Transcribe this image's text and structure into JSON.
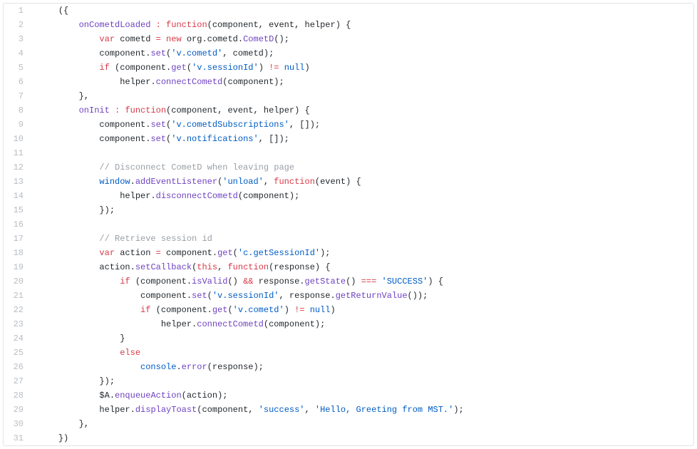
{
  "lines": [
    {
      "n": 1,
      "indent": 1,
      "tokens": [
        {
          "c": "t-punct",
          "t": "({"
        }
      ]
    },
    {
      "n": 2,
      "indent": 2,
      "tokens": [
        {
          "c": "t-func",
          "t": "onCometdLoaded"
        },
        {
          "c": "t-name",
          "t": " "
        },
        {
          "c": "t-op",
          "t": ":"
        },
        {
          "c": "t-name",
          "t": " "
        },
        {
          "c": "t-kw",
          "t": "function"
        },
        {
          "c": "t-punct",
          "t": "("
        },
        {
          "c": "t-name",
          "t": "component"
        },
        {
          "c": "t-punct",
          "t": ","
        },
        {
          "c": "t-name",
          "t": " event"
        },
        {
          "c": "t-punct",
          "t": ","
        },
        {
          "c": "t-name",
          "t": " helper"
        },
        {
          "c": "t-punct",
          "t": ")"
        },
        {
          "c": "t-name",
          "t": " "
        },
        {
          "c": "t-punct",
          "t": "{"
        }
      ]
    },
    {
      "n": 3,
      "indent": 3,
      "tokens": [
        {
          "c": "t-kw",
          "t": "var"
        },
        {
          "c": "t-name",
          "t": " cometd "
        },
        {
          "c": "t-op",
          "t": "="
        },
        {
          "c": "t-name",
          "t": " "
        },
        {
          "c": "t-new",
          "t": "new"
        },
        {
          "c": "t-name",
          "t": " org"
        },
        {
          "c": "t-punct",
          "t": "."
        },
        {
          "c": "t-name",
          "t": "cometd"
        },
        {
          "c": "t-punct",
          "t": "."
        },
        {
          "c": "t-func",
          "t": "CometD"
        },
        {
          "c": "t-punct",
          "t": "();"
        }
      ]
    },
    {
      "n": 4,
      "indent": 3,
      "tokens": [
        {
          "c": "t-name",
          "t": "component"
        },
        {
          "c": "t-punct",
          "t": "."
        },
        {
          "c": "t-func",
          "t": "set"
        },
        {
          "c": "t-punct",
          "t": "("
        },
        {
          "c": "t-str",
          "t": "'v.cometd'"
        },
        {
          "c": "t-punct",
          "t": ","
        },
        {
          "c": "t-name",
          "t": " cometd"
        },
        {
          "c": "t-punct",
          "t": ");"
        }
      ]
    },
    {
      "n": 5,
      "indent": 3,
      "tokens": [
        {
          "c": "t-kw",
          "t": "if"
        },
        {
          "c": "t-name",
          "t": " "
        },
        {
          "c": "t-punct",
          "t": "("
        },
        {
          "c": "t-name",
          "t": "component"
        },
        {
          "c": "t-punct",
          "t": "."
        },
        {
          "c": "t-func",
          "t": "get"
        },
        {
          "c": "t-punct",
          "t": "("
        },
        {
          "c": "t-str",
          "t": "'v.sessionId'"
        },
        {
          "c": "t-punct",
          "t": ")"
        },
        {
          "c": "t-name",
          "t": " "
        },
        {
          "c": "t-op",
          "t": "!="
        },
        {
          "c": "t-name",
          "t": " "
        },
        {
          "c": "t-null",
          "t": "null"
        },
        {
          "c": "t-punct",
          "t": ")"
        }
      ]
    },
    {
      "n": 6,
      "indent": 4,
      "tokens": [
        {
          "c": "t-name",
          "t": "helper"
        },
        {
          "c": "t-punct",
          "t": "."
        },
        {
          "c": "t-func",
          "t": "connectCometd"
        },
        {
          "c": "t-punct",
          "t": "("
        },
        {
          "c": "t-name",
          "t": "component"
        },
        {
          "c": "t-punct",
          "t": ");"
        }
      ]
    },
    {
      "n": 7,
      "indent": 2,
      "tokens": [
        {
          "c": "t-punct",
          "t": "},"
        }
      ]
    },
    {
      "n": 8,
      "indent": 2,
      "tokens": [
        {
          "c": "t-func",
          "t": "onInit"
        },
        {
          "c": "t-name",
          "t": " "
        },
        {
          "c": "t-op",
          "t": ":"
        },
        {
          "c": "t-name",
          "t": " "
        },
        {
          "c": "t-kw",
          "t": "function"
        },
        {
          "c": "t-punct",
          "t": "("
        },
        {
          "c": "t-name",
          "t": "component"
        },
        {
          "c": "t-punct",
          "t": ","
        },
        {
          "c": "t-name",
          "t": " event"
        },
        {
          "c": "t-punct",
          "t": ","
        },
        {
          "c": "t-name",
          "t": " helper"
        },
        {
          "c": "t-punct",
          "t": ")"
        },
        {
          "c": "t-name",
          "t": " "
        },
        {
          "c": "t-punct",
          "t": "{"
        }
      ]
    },
    {
      "n": 9,
      "indent": 3,
      "tokens": [
        {
          "c": "t-name",
          "t": "component"
        },
        {
          "c": "t-punct",
          "t": "."
        },
        {
          "c": "t-func",
          "t": "set"
        },
        {
          "c": "t-punct",
          "t": "("
        },
        {
          "c": "t-str",
          "t": "'v.cometdSubscriptions'"
        },
        {
          "c": "t-punct",
          "t": ","
        },
        {
          "c": "t-name",
          "t": " "
        },
        {
          "c": "t-punct",
          "t": "[]);"
        }
      ]
    },
    {
      "n": 10,
      "indent": 3,
      "tokens": [
        {
          "c": "t-name",
          "t": "component"
        },
        {
          "c": "t-punct",
          "t": "."
        },
        {
          "c": "t-func",
          "t": "set"
        },
        {
          "c": "t-punct",
          "t": "("
        },
        {
          "c": "t-str",
          "t": "'v.notifications'"
        },
        {
          "c": "t-punct",
          "t": ","
        },
        {
          "c": "t-name",
          "t": " "
        },
        {
          "c": "t-punct",
          "t": "[]);"
        }
      ]
    },
    {
      "n": 11,
      "indent": 3,
      "tokens": []
    },
    {
      "n": 12,
      "indent": 3,
      "tokens": [
        {
          "c": "t-cmt",
          "t": "// Disconnect CometD when leaving page"
        }
      ]
    },
    {
      "n": 13,
      "indent": 3,
      "tokens": [
        {
          "c": "t-builtin",
          "t": "window"
        },
        {
          "c": "t-punct",
          "t": "."
        },
        {
          "c": "t-func",
          "t": "addEventListener"
        },
        {
          "c": "t-punct",
          "t": "("
        },
        {
          "c": "t-str",
          "t": "'unload'"
        },
        {
          "c": "t-punct",
          "t": ","
        },
        {
          "c": "t-name",
          "t": " "
        },
        {
          "c": "t-kw",
          "t": "function"
        },
        {
          "c": "t-punct",
          "t": "("
        },
        {
          "c": "t-name",
          "t": "event"
        },
        {
          "c": "t-punct",
          "t": ")"
        },
        {
          "c": "t-name",
          "t": " "
        },
        {
          "c": "t-punct",
          "t": "{"
        }
      ]
    },
    {
      "n": 14,
      "indent": 4,
      "tokens": [
        {
          "c": "t-name",
          "t": "helper"
        },
        {
          "c": "t-punct",
          "t": "."
        },
        {
          "c": "t-func",
          "t": "disconnectCometd"
        },
        {
          "c": "t-punct",
          "t": "("
        },
        {
          "c": "t-name",
          "t": "component"
        },
        {
          "c": "t-punct",
          "t": ");"
        }
      ]
    },
    {
      "n": 15,
      "indent": 3,
      "tokens": [
        {
          "c": "t-punct",
          "t": "});"
        }
      ]
    },
    {
      "n": 16,
      "indent": 3,
      "tokens": []
    },
    {
      "n": 17,
      "indent": 3,
      "tokens": [
        {
          "c": "t-cmt",
          "t": "// Retrieve session id"
        }
      ]
    },
    {
      "n": 18,
      "indent": 3,
      "tokens": [
        {
          "c": "t-kw",
          "t": "var"
        },
        {
          "c": "t-name",
          "t": " action "
        },
        {
          "c": "t-op",
          "t": "="
        },
        {
          "c": "t-name",
          "t": " component"
        },
        {
          "c": "t-punct",
          "t": "."
        },
        {
          "c": "t-func",
          "t": "get"
        },
        {
          "c": "t-punct",
          "t": "("
        },
        {
          "c": "t-str",
          "t": "'c.getSessionId'"
        },
        {
          "c": "t-punct",
          "t": ");"
        }
      ]
    },
    {
      "n": 19,
      "indent": 3,
      "tokens": [
        {
          "c": "t-name",
          "t": "action"
        },
        {
          "c": "t-punct",
          "t": "."
        },
        {
          "c": "t-func",
          "t": "setCallback"
        },
        {
          "c": "t-punct",
          "t": "("
        },
        {
          "c": "t-kw",
          "t": "this"
        },
        {
          "c": "t-punct",
          "t": ","
        },
        {
          "c": "t-name",
          "t": " "
        },
        {
          "c": "t-kw",
          "t": "function"
        },
        {
          "c": "t-punct",
          "t": "("
        },
        {
          "c": "t-name",
          "t": "response"
        },
        {
          "c": "t-punct",
          "t": ")"
        },
        {
          "c": "t-name",
          "t": " "
        },
        {
          "c": "t-punct",
          "t": "{"
        }
      ]
    },
    {
      "n": 20,
      "indent": 4,
      "tokens": [
        {
          "c": "t-kw",
          "t": "if"
        },
        {
          "c": "t-name",
          "t": " "
        },
        {
          "c": "t-punct",
          "t": "("
        },
        {
          "c": "t-name",
          "t": "component"
        },
        {
          "c": "t-punct",
          "t": "."
        },
        {
          "c": "t-func",
          "t": "isValid"
        },
        {
          "c": "t-punct",
          "t": "()"
        },
        {
          "c": "t-name",
          "t": " "
        },
        {
          "c": "t-op",
          "t": "&&"
        },
        {
          "c": "t-name",
          "t": " response"
        },
        {
          "c": "t-punct",
          "t": "."
        },
        {
          "c": "t-func",
          "t": "getState"
        },
        {
          "c": "t-punct",
          "t": "()"
        },
        {
          "c": "t-name",
          "t": " "
        },
        {
          "c": "t-op",
          "t": "==="
        },
        {
          "c": "t-name",
          "t": " "
        },
        {
          "c": "t-str",
          "t": "'SUCCESS'"
        },
        {
          "c": "t-punct",
          "t": ")"
        },
        {
          "c": "t-name",
          "t": " "
        },
        {
          "c": "t-punct",
          "t": "{"
        }
      ]
    },
    {
      "n": 21,
      "indent": 5,
      "tokens": [
        {
          "c": "t-name",
          "t": "component"
        },
        {
          "c": "t-punct",
          "t": "."
        },
        {
          "c": "t-func",
          "t": "set"
        },
        {
          "c": "t-punct",
          "t": "("
        },
        {
          "c": "t-str",
          "t": "'v.sessionId'"
        },
        {
          "c": "t-punct",
          "t": ","
        },
        {
          "c": "t-name",
          "t": " response"
        },
        {
          "c": "t-punct",
          "t": "."
        },
        {
          "c": "t-func",
          "t": "getReturnValue"
        },
        {
          "c": "t-punct",
          "t": "());"
        }
      ]
    },
    {
      "n": 22,
      "indent": 5,
      "tokens": [
        {
          "c": "t-kw",
          "t": "if"
        },
        {
          "c": "t-name",
          "t": " "
        },
        {
          "c": "t-punct",
          "t": "("
        },
        {
          "c": "t-name",
          "t": "component"
        },
        {
          "c": "t-punct",
          "t": "."
        },
        {
          "c": "t-func",
          "t": "get"
        },
        {
          "c": "t-punct",
          "t": "("
        },
        {
          "c": "t-str",
          "t": "'v.cometd'"
        },
        {
          "c": "t-punct",
          "t": ")"
        },
        {
          "c": "t-name",
          "t": " "
        },
        {
          "c": "t-op",
          "t": "!="
        },
        {
          "c": "t-name",
          "t": " "
        },
        {
          "c": "t-null",
          "t": "null"
        },
        {
          "c": "t-punct",
          "t": ")"
        }
      ]
    },
    {
      "n": 23,
      "indent": 6,
      "tokens": [
        {
          "c": "t-name",
          "t": "helper"
        },
        {
          "c": "t-punct",
          "t": "."
        },
        {
          "c": "t-func",
          "t": "connectCometd"
        },
        {
          "c": "t-punct",
          "t": "("
        },
        {
          "c": "t-name",
          "t": "component"
        },
        {
          "c": "t-punct",
          "t": ");"
        }
      ]
    },
    {
      "n": 24,
      "indent": 4,
      "tokens": [
        {
          "c": "t-punct",
          "t": "}"
        }
      ]
    },
    {
      "n": 25,
      "indent": 4,
      "tokens": [
        {
          "c": "t-kw",
          "t": "else"
        }
      ]
    },
    {
      "n": 26,
      "indent": 5,
      "tokens": [
        {
          "c": "t-builtin",
          "t": "console"
        },
        {
          "c": "t-punct",
          "t": "."
        },
        {
          "c": "t-func",
          "t": "error"
        },
        {
          "c": "t-punct",
          "t": "("
        },
        {
          "c": "t-name",
          "t": "response"
        },
        {
          "c": "t-punct",
          "t": ");"
        }
      ]
    },
    {
      "n": 27,
      "indent": 3,
      "tokens": [
        {
          "c": "t-punct",
          "t": "});"
        }
      ]
    },
    {
      "n": 28,
      "indent": 3,
      "tokens": [
        {
          "c": "t-name",
          "t": "$A"
        },
        {
          "c": "t-punct",
          "t": "."
        },
        {
          "c": "t-func",
          "t": "enqueueAction"
        },
        {
          "c": "t-punct",
          "t": "("
        },
        {
          "c": "t-name",
          "t": "action"
        },
        {
          "c": "t-punct",
          "t": ");"
        }
      ]
    },
    {
      "n": 29,
      "indent": 3,
      "tokens": [
        {
          "c": "t-name",
          "t": "helper"
        },
        {
          "c": "t-punct",
          "t": "."
        },
        {
          "c": "t-func",
          "t": "displayToast"
        },
        {
          "c": "t-punct",
          "t": "("
        },
        {
          "c": "t-name",
          "t": "component"
        },
        {
          "c": "t-punct",
          "t": ","
        },
        {
          "c": "t-name",
          "t": " "
        },
        {
          "c": "t-str",
          "t": "'success'"
        },
        {
          "c": "t-punct",
          "t": ","
        },
        {
          "c": "t-name",
          "t": " "
        },
        {
          "c": "t-str",
          "t": "'Hello, Greeting from MST.'"
        },
        {
          "c": "t-punct",
          "t": ");"
        }
      ]
    },
    {
      "n": 30,
      "indent": 2,
      "tokens": [
        {
          "c": "t-punct",
          "t": "},"
        }
      ]
    },
    {
      "n": 31,
      "indent": 1,
      "tokens": [
        {
          "c": "t-punct",
          "t": "})"
        }
      ]
    }
  ],
  "indentUnit": "    "
}
